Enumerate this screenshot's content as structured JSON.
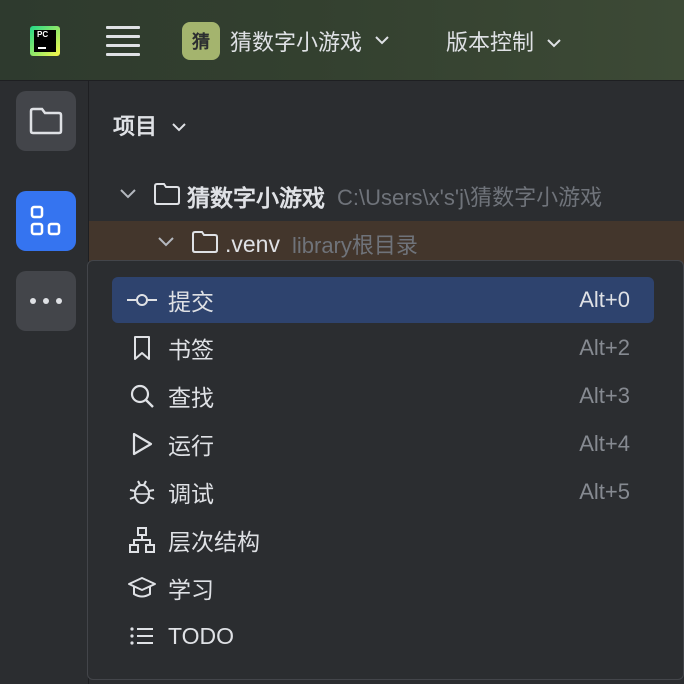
{
  "topbar": {
    "logo_text": "PC",
    "project_chip_letter": "猜",
    "project_name": "猜数字小游戏",
    "vcs_label": "版本控制"
  },
  "sidebar": {
    "buttons": [
      {
        "name": "project-folder-icon",
        "active": false
      },
      {
        "name": "structure-icon",
        "active": true
      },
      {
        "name": "more-icon",
        "active": false
      }
    ]
  },
  "panel": {
    "title": "项目",
    "tree": [
      {
        "name": "猜数字小游戏",
        "hint": "C:\\Users\\x's'j\\猜数字小游戏"
      },
      {
        "name": ".venv",
        "hint": "library根目录"
      }
    ]
  },
  "popup_menu": {
    "items": [
      {
        "label": "提交",
        "shortcut": "Alt+0",
        "icon": "commit-icon",
        "selected": true
      },
      {
        "label": "书签",
        "shortcut": "Alt+2",
        "icon": "bookmark-icon",
        "selected": false
      },
      {
        "label": "查找",
        "shortcut": "Alt+3",
        "icon": "search-icon",
        "selected": false
      },
      {
        "label": "运行",
        "shortcut": "Alt+4",
        "icon": "run-icon",
        "selected": false
      },
      {
        "label": "调试",
        "shortcut": "Alt+5",
        "icon": "debug-icon",
        "selected": false
      },
      {
        "label": "层次结构",
        "shortcut": "",
        "icon": "hierarchy-icon",
        "selected": false
      },
      {
        "label": "学习",
        "shortcut": "",
        "icon": "learn-icon",
        "selected": false
      },
      {
        "label": "TODO",
        "shortcut": "",
        "icon": "todo-icon",
        "selected": false
      }
    ]
  },
  "colors": {
    "background": "#2b2d30",
    "accent": "#3574f0",
    "selection": "#2e436e",
    "highlight_row": "#43362c",
    "project_chip": "#a4b46e"
  }
}
